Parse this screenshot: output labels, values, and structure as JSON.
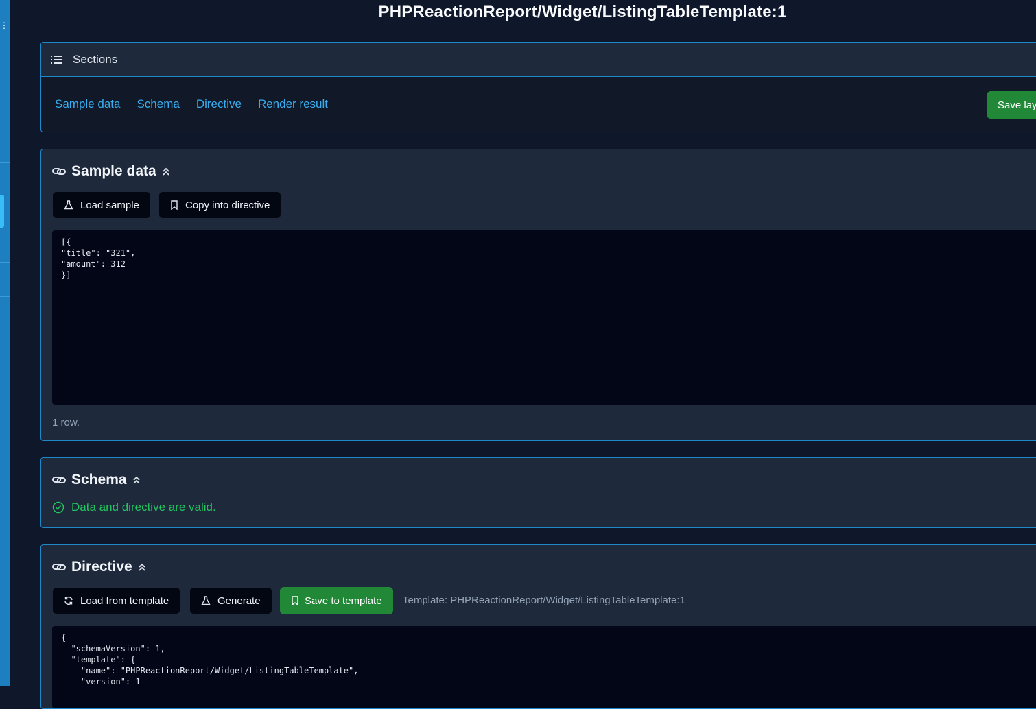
{
  "page": {
    "title": "PHPReactionReport/Widget/ListingTableTemplate:1"
  },
  "sections_nav": {
    "heading": "Sections",
    "links": [
      "Sample data",
      "Schema",
      "Directive",
      "Render result"
    ],
    "save_layout_label": "Save lay"
  },
  "sample_data": {
    "title": "Sample data",
    "load_sample_label": "Load sample",
    "copy_into_directive_label": "Copy into directive",
    "code": "[{\n\"title\": \"321\",\n\"amount\": 312\n}]",
    "row_count": "1 row."
  },
  "schema": {
    "title": "Schema",
    "status": "Data and directive are valid."
  },
  "directive": {
    "title": "Directive",
    "load_from_template_label": "Load from template",
    "generate_label": "Generate",
    "save_to_template_label": "Save to template",
    "template_info": "Template: PHPReactionReport/Widget/ListingTableTemplate:1",
    "code": "{\n  \"schemaVersion\": 1,\n  \"template\": {\n    \"name\": \"PHPReactionReport/Widget/ListingTableTemplate\",\n    \"version\": 1"
  },
  "colors": {
    "background": "#0f172a",
    "card": "#1e293b",
    "border": "#1e88c8",
    "link": "#38aef0",
    "success": "#22c55e",
    "primary_button": "#218838"
  }
}
